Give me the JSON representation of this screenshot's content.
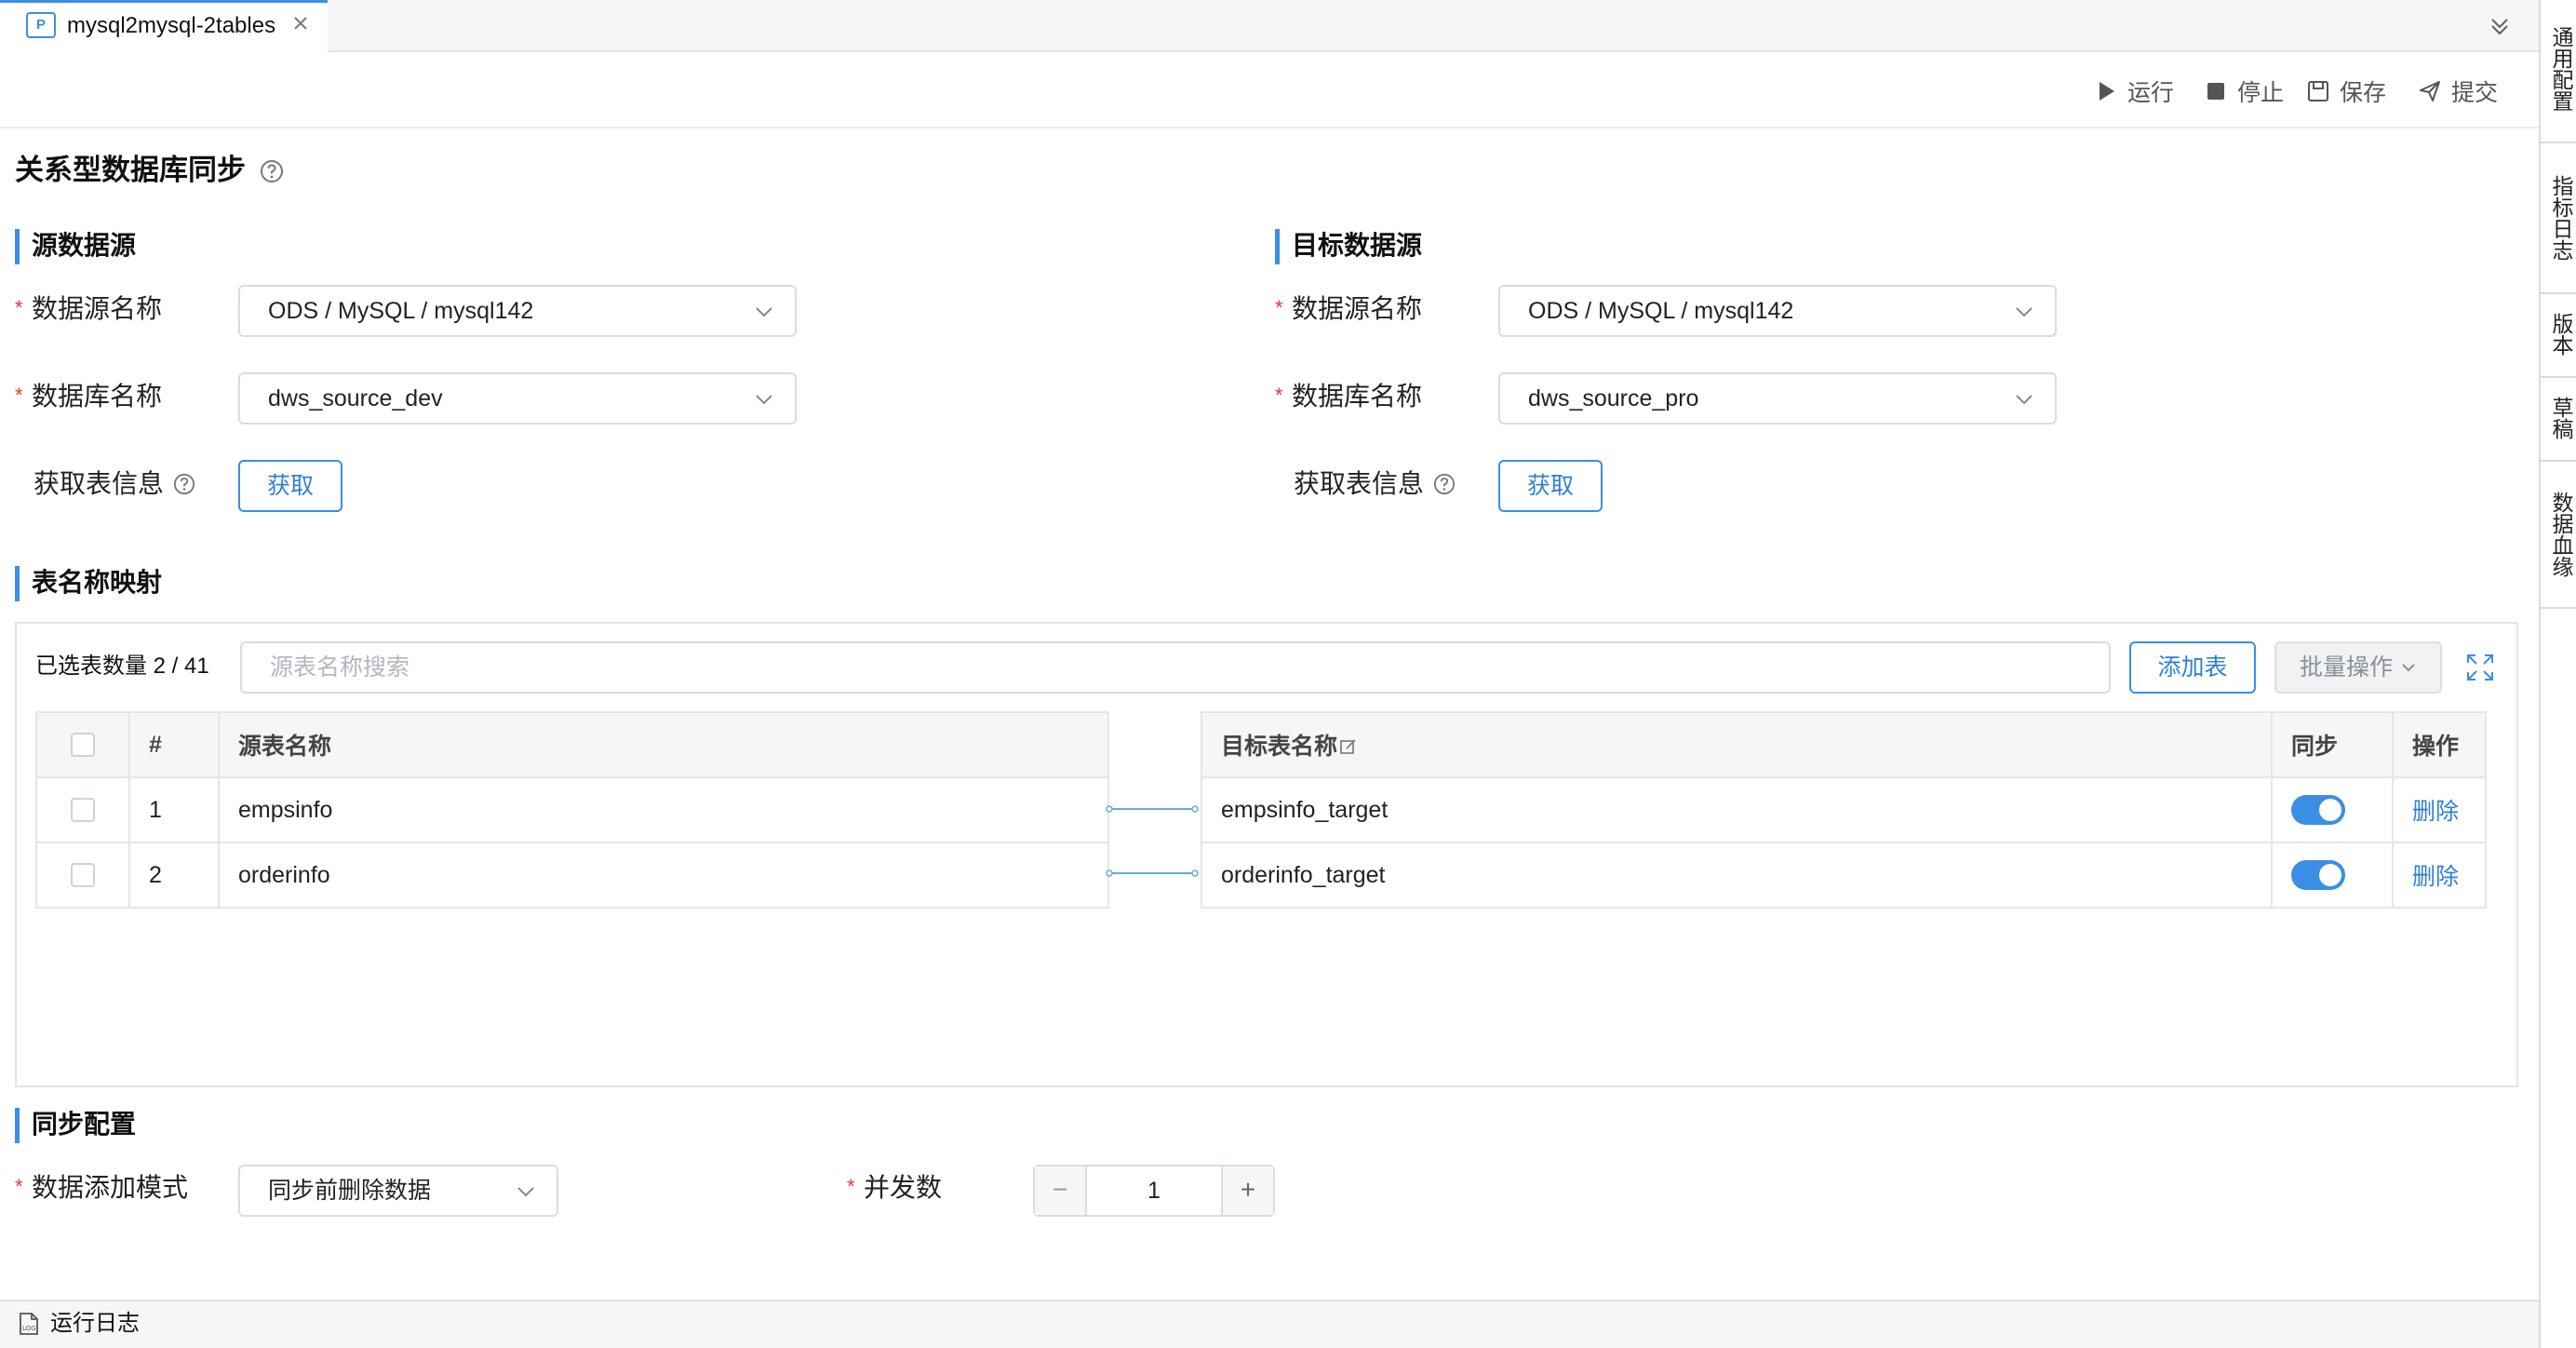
{
  "tab": {
    "icon_text": "P",
    "title": "mysql2mysql-2tables"
  },
  "side_panel": [
    "通用配置",
    "指标日志",
    "版本",
    "草稿",
    "数据血缘"
  ],
  "toolbar": {
    "run": "运行",
    "stop": "停止",
    "save": "保存",
    "submit": "提交"
  },
  "page_title": "关系型数据库同步",
  "source": {
    "section_title": "源数据源",
    "datasource_label": "数据源名称",
    "datasource_value": "ODS / MySQL / mysql142",
    "database_label": "数据库名称",
    "database_value": "dws_source_dev",
    "fetch_label": "获取表信息",
    "fetch_button": "获取"
  },
  "target": {
    "section_title": "目标数据源",
    "datasource_label": "数据源名称",
    "datasource_value": "ODS / MySQL / mysql142",
    "database_label": "数据库名称",
    "database_value": "dws_source_pro",
    "fetch_label": "获取表信息",
    "fetch_button": "获取"
  },
  "mapping": {
    "section_title": "表名称映射",
    "selected_count": "已选表数量 2 / 41",
    "search_placeholder": "源表名称搜索",
    "add_button": "添加表",
    "batch_button": "批量操作",
    "source_headers": {
      "index": "#",
      "name": "源表名称"
    },
    "target_headers": {
      "name": "目标表名称",
      "sync": "同步",
      "action": "操作"
    },
    "rows": [
      {
        "index": "1",
        "source": "empsinfo",
        "target": "empsinfo_target",
        "sync": true,
        "action": "删除"
      },
      {
        "index": "2",
        "source": "orderinfo",
        "target": "orderinfo_target",
        "sync": true,
        "action": "删除"
      }
    ]
  },
  "sync_config": {
    "section_title": "同步配置",
    "mode_label": "数据添加模式",
    "mode_value": "同步前删除数据",
    "concurrency_label": "并发数",
    "concurrency_value": "1",
    "minus": "−",
    "plus": "+"
  },
  "bottom": {
    "log_label": "运行日志"
  },
  "colors": {
    "accent": "#3a8ee6",
    "required": "#e53935"
  }
}
